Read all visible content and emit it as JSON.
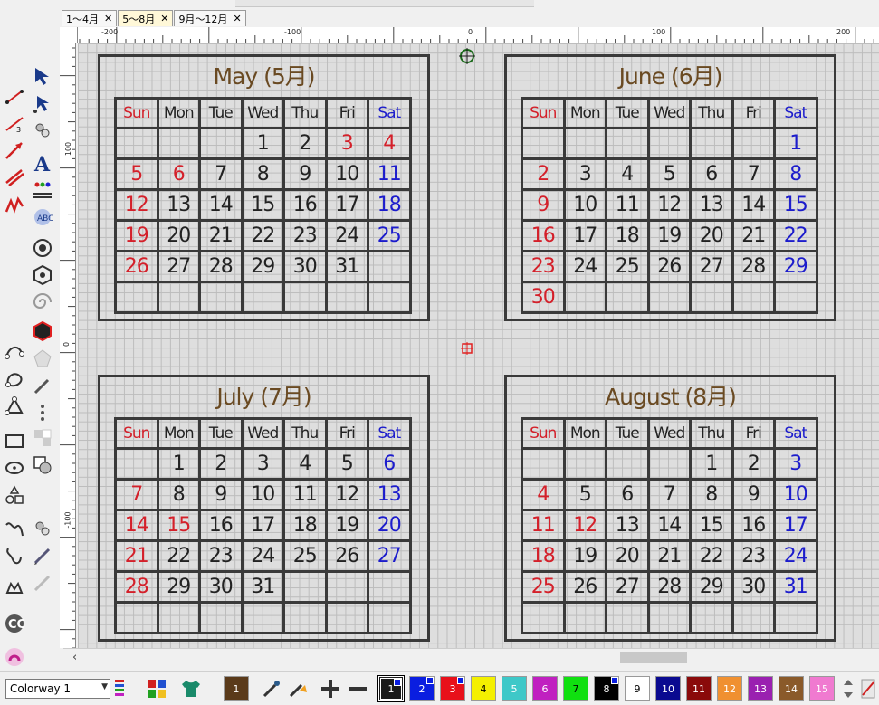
{
  "tabs": [
    {
      "label": "1～4月",
      "active": false
    },
    {
      "label": "5～8月",
      "active": true
    },
    {
      "label": "9月～12月",
      "active": false
    }
  ],
  "ruler": {
    "top_labels": [
      "-200",
      "-100",
      "0",
      "100",
      "200"
    ],
    "left_labels": [
      "100",
      "0",
      "-100"
    ]
  },
  "weekdays": [
    "Sun",
    "Mon",
    "Tue",
    "Wed",
    "Thu",
    "Fri",
    "Sat"
  ],
  "calendars": [
    {
      "title": "May (5月)",
      "rows": [
        [
          "",
          "",
          "",
          "1",
          "2",
          "3",
          "4"
        ],
        [
          "5",
          "6",
          "7",
          "8",
          "9",
          "10",
          "11"
        ],
        [
          "12",
          "13",
          "14",
          "15",
          "16",
          "17",
          "18"
        ],
        [
          "19",
          "20",
          "21",
          "22",
          "23",
          "24",
          "25"
        ],
        [
          "26",
          "27",
          "28",
          "29",
          "30",
          "31",
          ""
        ],
        [
          "",
          "",
          "",
          "",
          "",
          "",
          ""
        ]
      ],
      "red_days": [
        "3",
        "4",
        "6"
      ]
    },
    {
      "title": "June (6月)",
      "rows": [
        [
          "",
          "",
          "",
          "",
          "",
          "",
          "1"
        ],
        [
          "2",
          "3",
          "4",
          "5",
          "6",
          "7",
          "8"
        ],
        [
          "9",
          "10",
          "11",
          "12",
          "13",
          "14",
          "15"
        ],
        [
          "16",
          "17",
          "18",
          "19",
          "20",
          "21",
          "22"
        ],
        [
          "23",
          "24",
          "25",
          "26",
          "27",
          "28",
          "29"
        ],
        [
          "30",
          "",
          "",
          "",
          "",
          "",
          ""
        ]
      ],
      "red_days": []
    },
    {
      "title": "July (7月)",
      "rows": [
        [
          "",
          "1",
          "2",
          "3",
          "4",
          "5",
          "6"
        ],
        [
          "7",
          "8",
          "9",
          "10",
          "11",
          "12",
          "13"
        ],
        [
          "14",
          "15",
          "16",
          "17",
          "18",
          "19",
          "20"
        ],
        [
          "21",
          "22",
          "23",
          "24",
          "25",
          "26",
          "27"
        ],
        [
          "28",
          "29",
          "30",
          "31",
          "",
          "",
          ""
        ],
        [
          "",
          "",
          "",
          "",
          "",
          "",
          ""
        ]
      ],
      "red_days": [
        "15"
      ]
    },
    {
      "title": "August (8月)",
      "rows": [
        [
          "",
          "",
          "",
          "",
          "1",
          "2",
          "3"
        ],
        [
          "4",
          "5",
          "6",
          "7",
          "8",
          "9",
          "10"
        ],
        [
          "11",
          "12",
          "13",
          "14",
          "15",
          "16",
          "17"
        ],
        [
          "18",
          "19",
          "20",
          "21",
          "22",
          "23",
          "24"
        ],
        [
          "25",
          "26",
          "27",
          "28",
          "29",
          "30",
          "31"
        ],
        [
          "",
          "",
          "",
          "",
          "",
          "",
          ""
        ]
      ],
      "red_days": [
        "12"
      ]
    }
  ],
  "colors": {
    "sunday": "#d4202a",
    "saturday": "#1c1ccc",
    "title": "#6a4a22",
    "grid": "#3a3a3a"
  },
  "bottom": {
    "colorway_label": "Colorway 1",
    "current_color_label": "1",
    "palette": [
      {
        "label": "1",
        "color": "#1a1a1a",
        "fg": "#ffffff"
      },
      {
        "label": "2",
        "color": "#0a1ee0",
        "fg": "#ffffff"
      },
      {
        "label": "3",
        "color": "#e8101a",
        "fg": "#ffffff"
      },
      {
        "label": "4",
        "color": "#f4f000",
        "fg": "#000000"
      },
      {
        "label": "5",
        "color": "#3ec8c8",
        "fg": "#ffffff"
      },
      {
        "label": "6",
        "color": "#c020c0",
        "fg": "#ffffff"
      },
      {
        "label": "7",
        "color": "#10e010",
        "fg": "#000000"
      },
      {
        "label": "8",
        "color": "#000000",
        "fg": "#ffffff"
      },
      {
        "label": "9",
        "color": "#ffffff",
        "fg": "#000000"
      },
      {
        "label": "10",
        "color": "#0a0a90",
        "fg": "#ffffff"
      },
      {
        "label": "11",
        "color": "#8a0a0a",
        "fg": "#ffffff"
      },
      {
        "label": "12",
        "color": "#f09030",
        "fg": "#ffffff"
      },
      {
        "label": "13",
        "color": "#9a20b0",
        "fg": "#ffffff"
      },
      {
        "label": "14",
        "color": "#8a5a2a",
        "fg": "#ffffff"
      },
      {
        "label": "15",
        "color": "#f07ad0",
        "fg": "#ffffff"
      }
    ]
  }
}
